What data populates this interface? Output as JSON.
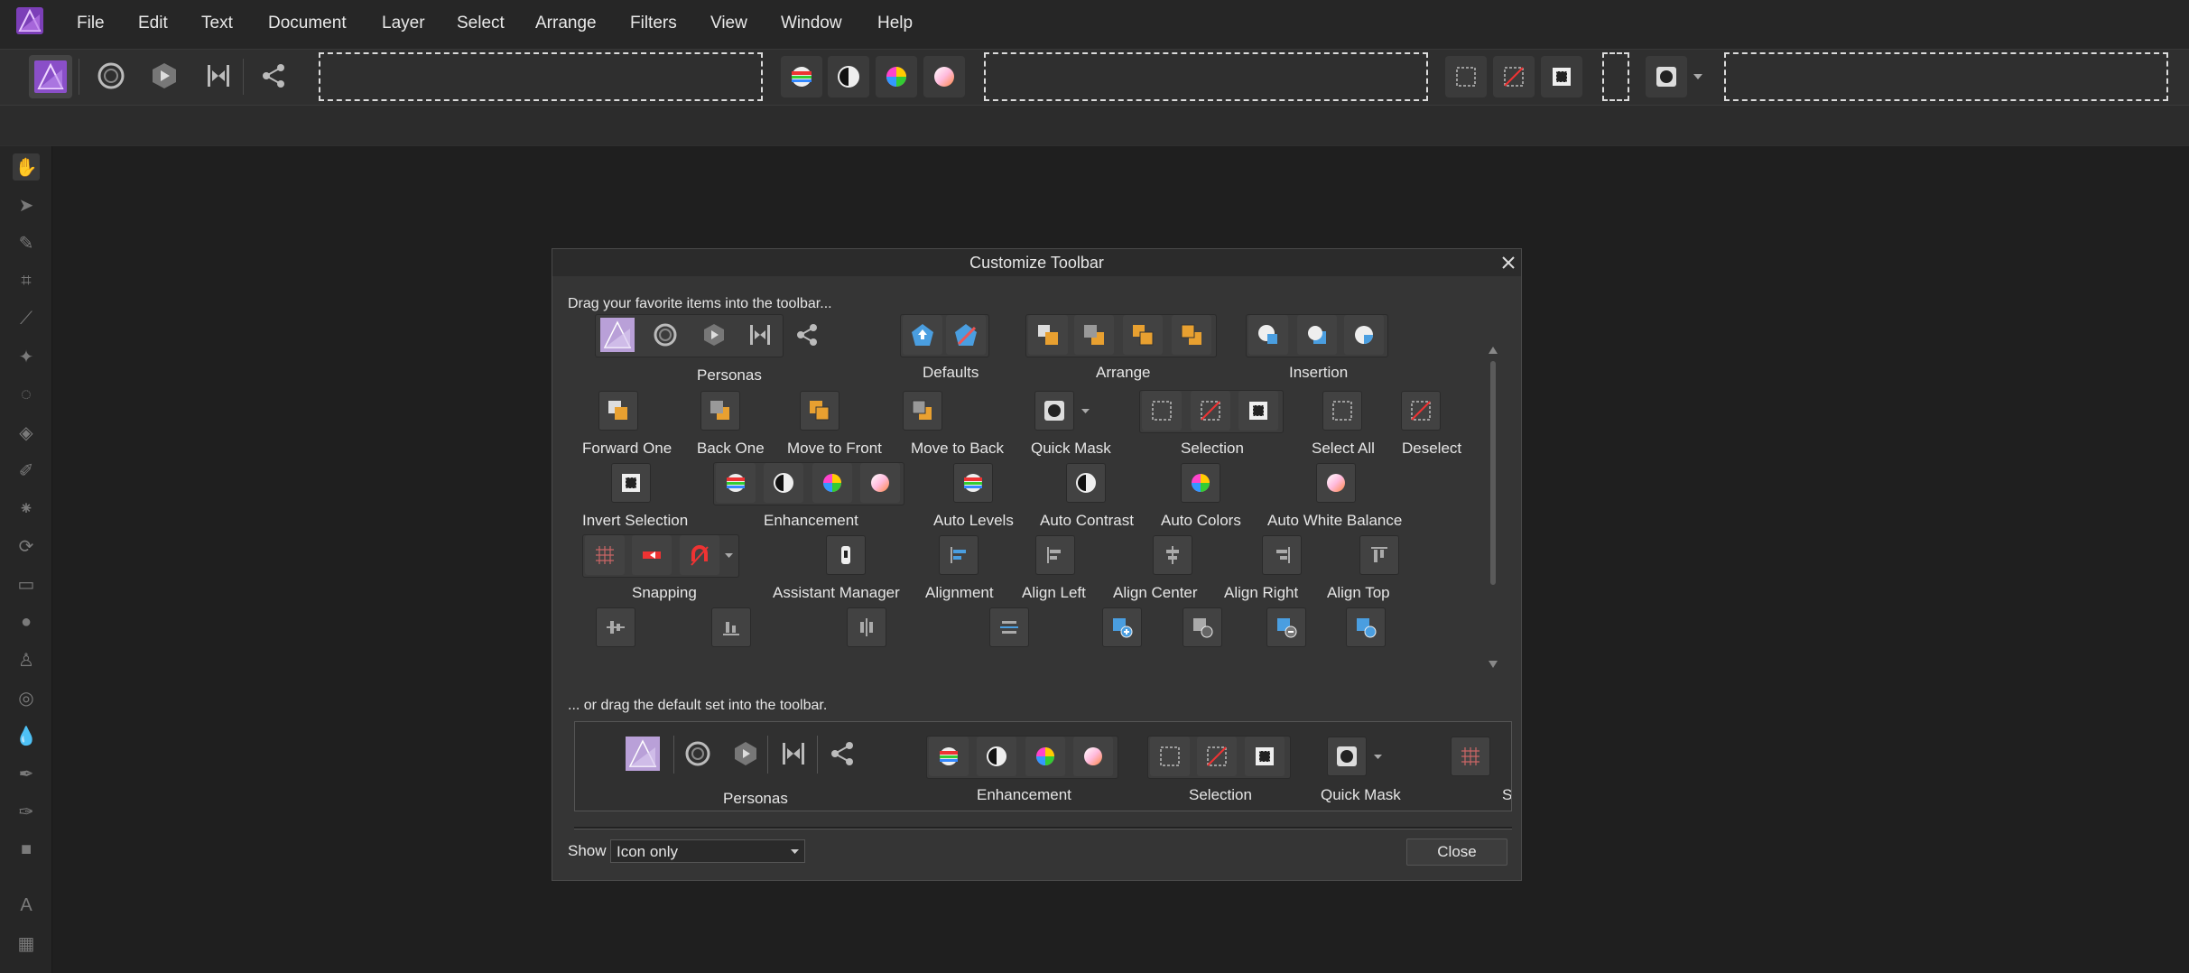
{
  "menu": [
    "File",
    "Edit",
    "Text",
    "Document",
    "Layer",
    "Select",
    "Arrange",
    "Filters",
    "View",
    "Window",
    "Help"
  ],
  "dialog": {
    "title": "Customize Toolbar",
    "instruction": "Drag your favorite items into the toolbar...",
    "default_instruction": "... or drag the default set into the toolbar.",
    "items": {
      "personas": "Personas",
      "defaults": "Defaults",
      "arrange": "Arrange",
      "insertion": "Insertion",
      "forward_one": "Forward One",
      "back_one": "Back One",
      "move_to_front": "Move to Front",
      "move_to_back": "Move to Back",
      "quick_mask": "Quick Mask",
      "selection": "Selection",
      "select_all": "Select All",
      "deselect": "Deselect",
      "invert_selection": "Invert Selection",
      "enhancement": "Enhancement",
      "auto_levels": "Auto Levels",
      "auto_contrast": "Auto Contrast",
      "auto_colors": "Auto Colors",
      "auto_white_balance": "Auto White Balance",
      "snapping": "Snapping",
      "assistant_manager": "Assistant Manager",
      "alignment": "Alignment",
      "align_left": "Align Left",
      "align_center": "Align Center",
      "align_right": "Align Right",
      "align_top": "Align Top"
    },
    "default_set": {
      "personas": "Personas",
      "enhancement": "Enhancement",
      "selection": "Selection",
      "quick_mask": "Quick Mask",
      "cut_label": "S"
    },
    "show_label": "Show",
    "show_value": "Icon only",
    "close_button": "Close"
  },
  "colors": {
    "accent": "#9b59d0",
    "background": "#1f1f1f",
    "dialog": "#353535"
  }
}
